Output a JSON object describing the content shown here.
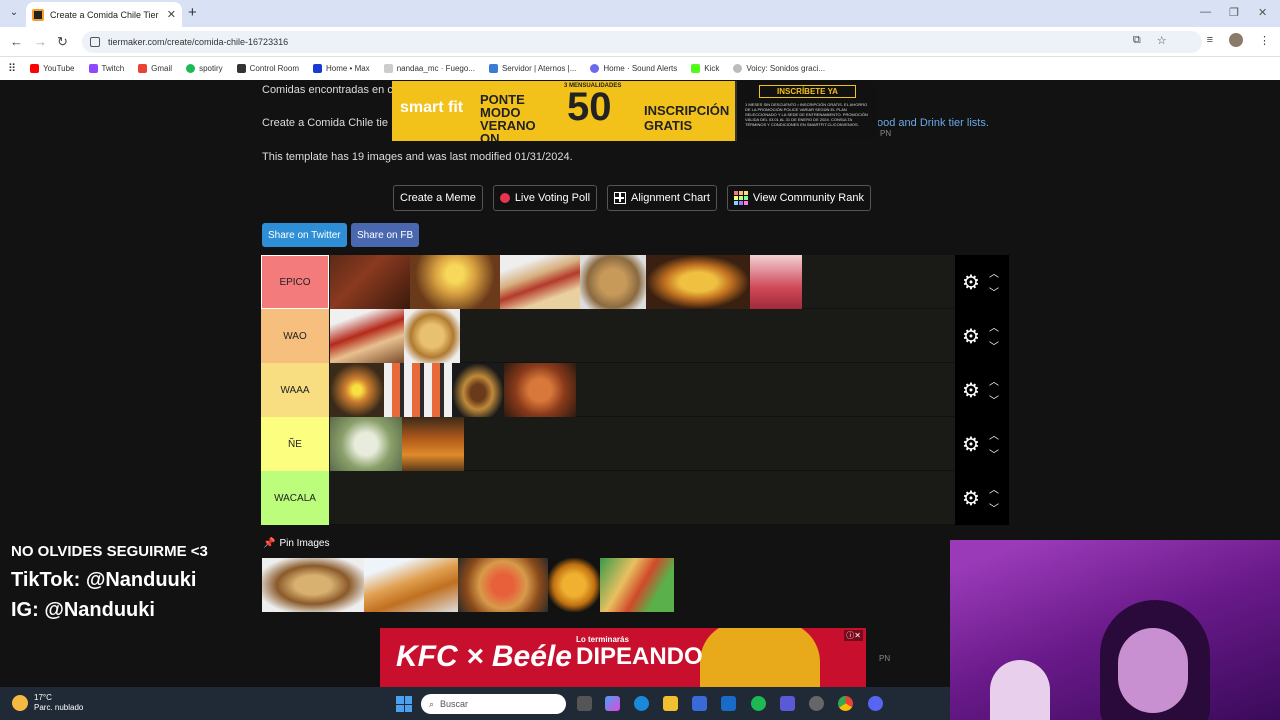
{
  "browser": {
    "tab_title": "Create a Comida Chile Tier List",
    "url": "tiermaker.com/create/comida-chile-16723316",
    "bookmarks": [
      "YouTube",
      "Twitch",
      "Gmail",
      "spotiry",
      "Control Room",
      "Home • Max",
      "nandaa_mc · Fuego...",
      "Servidor | Aternos |...",
      "Home · Sound Alerts",
      "Kick",
      "Voicy: Sonidos graci..."
    ]
  },
  "page": {
    "found_text": "Comidas encontradas en c",
    "create_text": "Create a Comida Chile tie",
    "link_text": "ood and Drink tier lists.",
    "template_info": "This template has 19 images and was last modified 01/31/2024.",
    "buttons": {
      "meme": "Create a Meme",
      "poll": "Live Voting Poll",
      "alignment": "Alignment Chart",
      "rank": "View Community Rank"
    },
    "share_twitter": "Share on Twitter",
    "share_fb": "Share on FB",
    "pin_images": "Pin Images"
  },
  "tiers": [
    {
      "label": "EPICO",
      "color": "#f37b7b"
    },
    {
      "label": "WAO",
      "color": "#f7bf7e"
    },
    {
      "label": "WAAA",
      "color": "#f8de80"
    },
    {
      "label": "ÑE",
      "color": "#fcfe80"
    },
    {
      "label": "WACALA",
      "color": "#bcfe7c"
    }
  ],
  "ad_top": {
    "brand": "smart fit",
    "headline": "PONTE MODO VERANO ON",
    "promo": "3 MENSUALIDADES",
    "promo_value": "50",
    "cta": "INSCRIPCIÓN GRATIS",
    "cta2": "INSCRÍBETE YA",
    "legal": "1 MESES SIN DESCUENTO • INSCRIPCIÓN GRATIS. EL AHORRO DE LA PROMOCIÓN POLICE VARIAR SEGÚN EL PLAN SELECCIONADO Y LA SEDE DE ENTRENAMIENTO. PROMOCIÓN VÁLIDA DEL 03.01 AL 31 DE ENERO DE 2024. CONSULTA TÉRMINOS Y CONDICIONES EN SMARTFIT.CL/CONVENIOS."
  },
  "ad_bottom": {
    "brand": "KFC × Beéle",
    "tagline": "Lo terminarás",
    "headline": "DIPEANDO"
  },
  "ad_label": "PN",
  "overlay": {
    "line1": "NO OLVIDES SEGUIRME <3",
    "line2": "TikTok: @Nanduuki",
    "line3": "IG: @Nanduuki"
  },
  "taskbar": {
    "temp": "17°C",
    "weather": "Parc. nublado",
    "search": "Buscar"
  }
}
